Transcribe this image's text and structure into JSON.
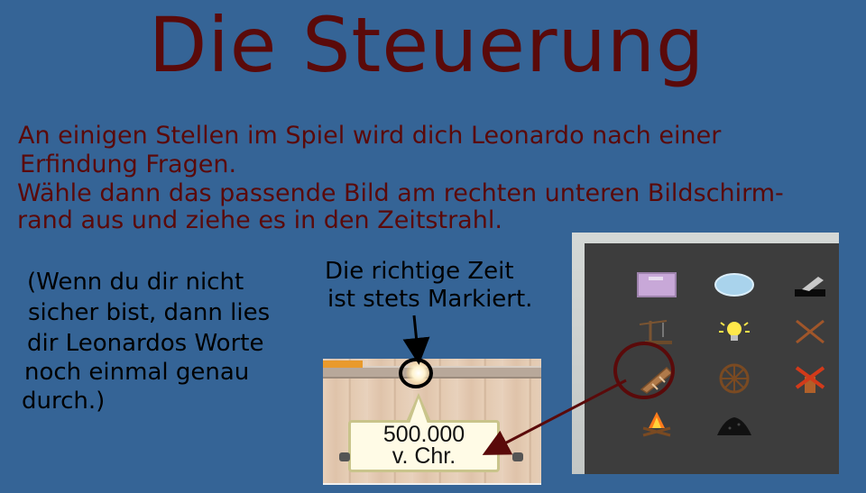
{
  "title": "Die Steuerung",
  "intro": {
    "line1": "An einigen Stellen im Spiel wird dich Leonardo nach einer",
    "line2": "Erfindung Fragen.",
    "line3": "Wähle dann das passende Bild am rechten unteren Bildschirm-",
    "line4": "rand aus und ziehe es in den Zeitstrahl."
  },
  "note": {
    "line1": "(Wenn du dir nicht",
    "line2": "sicher bist, dann lies",
    "line3": "dir Leonardos Worte",
    "line4": "noch einmal genau",
    "line5": "durch.)"
  },
  "hint": {
    "line1": "Die richtige Zeit",
    "line2": "ist stets Markiert."
  },
  "timeline": {
    "date_line1": "500.000",
    "date_line2": "v. Chr."
  },
  "inventory": {
    "items": [
      {
        "icon": "book-icon"
      },
      {
        "icon": "lens-icon"
      },
      {
        "icon": "cannon-icon"
      },
      {
        "icon": "crane-icon"
      },
      {
        "icon": "lightbulb-icon"
      },
      {
        "icon": "crossed-sticks-icon"
      },
      {
        "icon": "telescope-icon",
        "selected": true
      },
      {
        "icon": "wheel-icon"
      },
      {
        "icon": "windmill-icon"
      },
      {
        "icon": "campfire-icon"
      },
      {
        "icon": "coal-pile-icon"
      }
    ]
  },
  "colors": {
    "background": "#356496",
    "title_text": "#5a0a0a",
    "selection_ring": "#5a0a0a"
  }
}
